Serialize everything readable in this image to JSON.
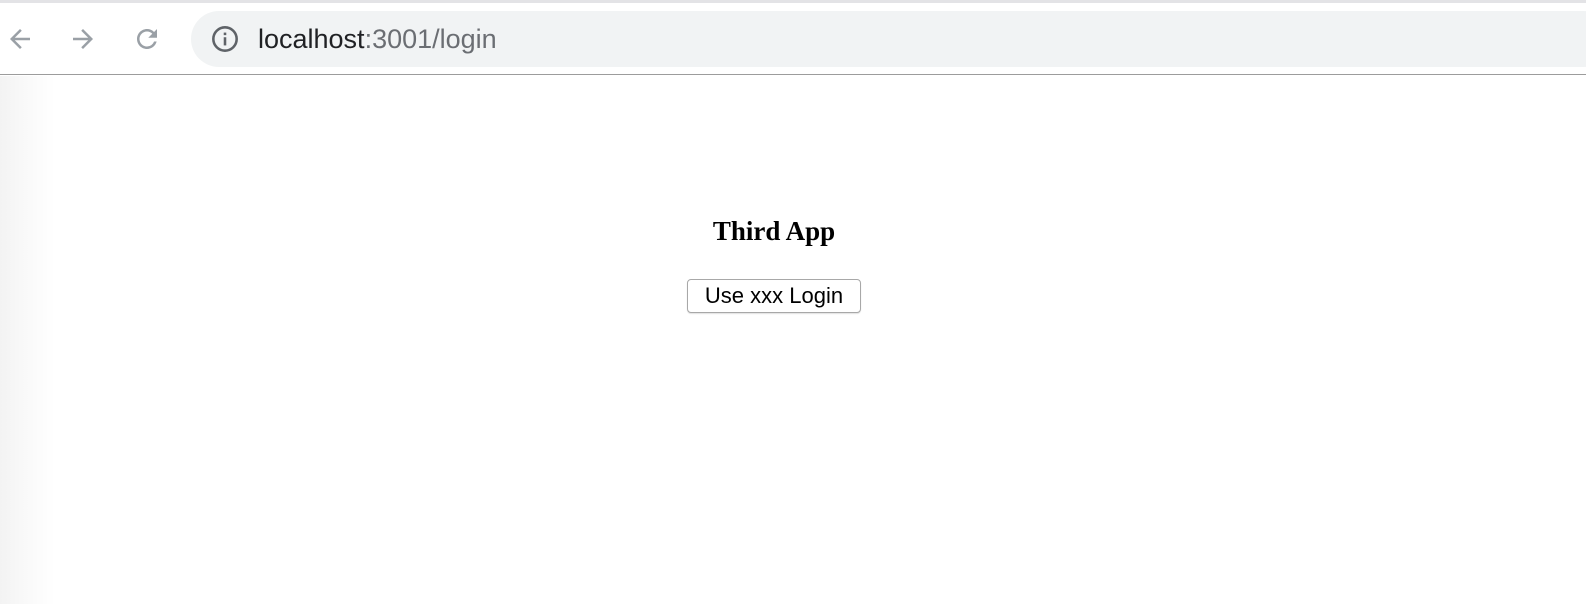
{
  "browser": {
    "nav": {
      "back_icon": "arrow-left-icon",
      "forward_icon": "arrow-right-icon",
      "reload_icon": "reload-icon"
    },
    "address_bar": {
      "info_icon": "info-icon",
      "url_host": "localhost",
      "url_rest": ":3001/login"
    }
  },
  "page": {
    "title": "Third App",
    "login_button_label": "Use xxx Login"
  },
  "colors": {
    "omnibox_bg": "#f1f3f4",
    "nav_icon": "#9aa0a6",
    "url_host": "#202124",
    "url_rest": "#6b6e73"
  }
}
